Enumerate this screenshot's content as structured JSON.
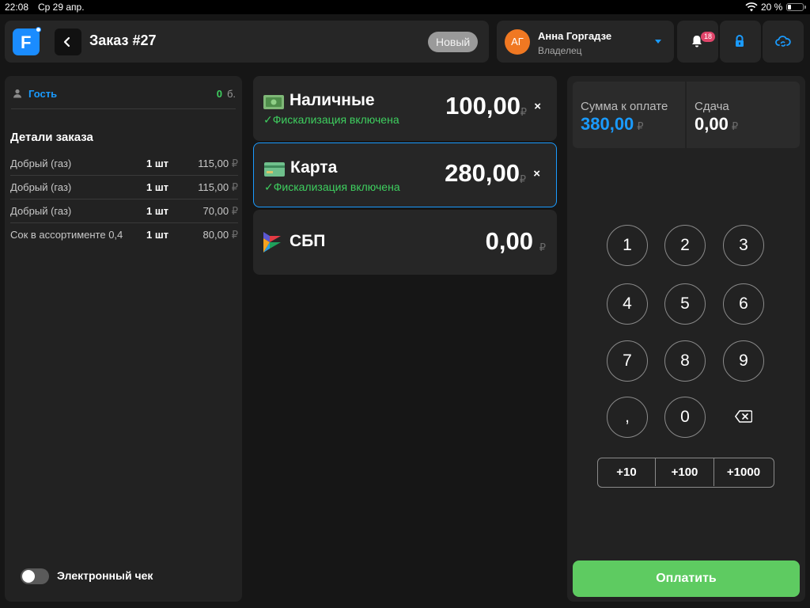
{
  "status_bar": {
    "time": "22:08",
    "date": "Ср 29 апр.",
    "battery_percent": "20 %",
    "battery_level": 0.2
  },
  "header": {
    "logo_letter": "F",
    "order_title": "Заказ #27",
    "order_status": "Новый",
    "user": {
      "initials": "АГ",
      "name": "Анна Горгадзе",
      "role": "Владелец"
    },
    "notifications_count": "18"
  },
  "order": {
    "guest_label": "Гость",
    "guest_points": "0",
    "guest_points_unit": "б.",
    "details_title": "Детали заказа",
    "items": [
      {
        "name": "Добрый (газ)",
        "qty": "1 шт",
        "price": "115,00"
      },
      {
        "name": "Добрый (газ)",
        "qty": "1 шт",
        "price": "115,00"
      },
      {
        "name": "Добрый (газ)",
        "qty": "1 шт",
        "price": "70,00"
      },
      {
        "name": "Сок в ассортименте 0,4",
        "qty": "1 шт",
        "price": "80,00"
      }
    ],
    "e_receipt_label": "Электронный чек",
    "e_receipt_enabled": false
  },
  "currency_symbol": "₽",
  "payments": [
    {
      "name": "Наличные",
      "amount": "100,00",
      "fiscal": "Фискализация включена",
      "selected": false,
      "close": "×"
    },
    {
      "name": "Карта",
      "amount": "280,00",
      "fiscal": "Фискализация включена",
      "selected": true,
      "close": "×"
    },
    {
      "name": "СБП",
      "amount": "0,00",
      "fiscal": "",
      "selected": false,
      "close": ""
    }
  ],
  "summary": {
    "to_pay_label": "Сумма к оплате",
    "to_pay_value": "380,00",
    "change_label": "Сдача",
    "change_value": "0,00"
  },
  "keypad": {
    "keys": [
      "1",
      "2",
      "3",
      "4",
      "5",
      "6",
      "7",
      "8",
      "9",
      ",",
      "0"
    ],
    "backspace_icon": "backspace-icon",
    "quick_add": [
      "+10",
      "+100",
      "+1000"
    ]
  },
  "pay_button_label": "Оплатить",
  "colors": {
    "accent_blue": "#1a9bff",
    "success_green": "#3ecf5f",
    "pay_button": "#5ecb61",
    "avatar": "#f07822",
    "badge": "#e0456a"
  }
}
